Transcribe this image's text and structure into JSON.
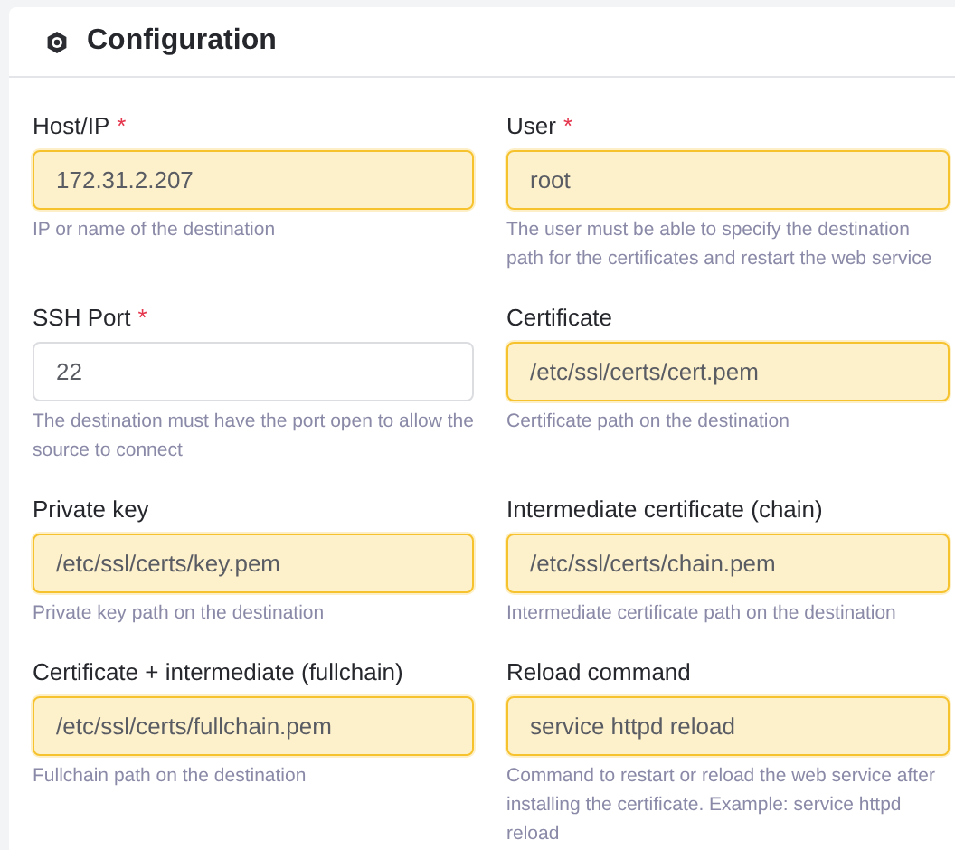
{
  "card": {
    "title": "Configuration"
  },
  "fields": [
    {
      "label": "Host/IP",
      "required_mark": "*",
      "value": "172.31.2.207",
      "highlighted": true,
      "hint": "IP or name of the destination"
    },
    {
      "label": "User",
      "required_mark": "*",
      "value": "root",
      "highlighted": true,
      "hint": "The user must be able to specify the destination path for the certificates and restart the web service"
    },
    {
      "label": "SSH Port",
      "required_mark": "*",
      "value": "22",
      "highlighted": false,
      "hint": "The destination must have the port open to allow the source to connect"
    },
    {
      "label": "Certificate",
      "value": "/etc/ssl/certs/cert.pem",
      "highlighted": true,
      "hint": "Certificate path on the destination"
    },
    {
      "label": "Private key",
      "value": "/etc/ssl/certs/key.pem",
      "highlighted": true,
      "hint": "Private key path on the destination"
    },
    {
      "label": "Intermediate certificate (chain)",
      "value": "/etc/ssl/certs/chain.pem",
      "highlighted": true,
      "hint": "Intermediate certificate path on the destination"
    },
    {
      "label": "Certificate + intermediate (fullchain)",
      "value": "/etc/ssl/certs/fullchain.pem",
      "highlighted": true,
      "hint": "Fullchain path on the destination"
    },
    {
      "label": "Reload command",
      "value": "service httpd reload",
      "highlighted": true,
      "hint": "Command to restart or reload the web service after installing the certificate. Example: service httpd reload"
    }
  ]
}
